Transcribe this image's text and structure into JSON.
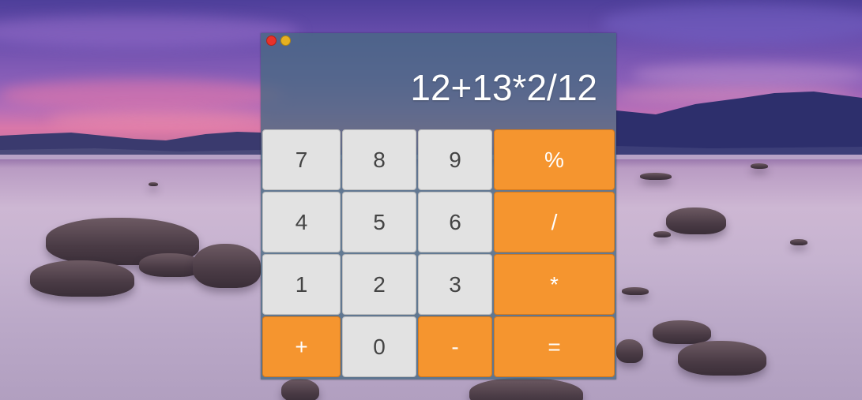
{
  "window": {
    "controls": [
      "close-dot",
      "minimize-dot"
    ]
  },
  "display": {
    "expression": "12+13*2/12"
  },
  "keys": {
    "k7": "7",
    "k8": "8",
    "k9": "9",
    "percent": "%",
    "k4": "4",
    "k5": "5",
    "k6": "6",
    "divide": "/",
    "k1": "1",
    "k2": "2",
    "k3": "3",
    "multiply": "*",
    "plus": "+",
    "k0": "0",
    "minus": "-",
    "equals": "="
  },
  "colors": {
    "operator_key": "#f5952f",
    "number_key": "#e2e2e2",
    "close_dot": "#e8322a",
    "minimize_dot": "#e6b021"
  }
}
